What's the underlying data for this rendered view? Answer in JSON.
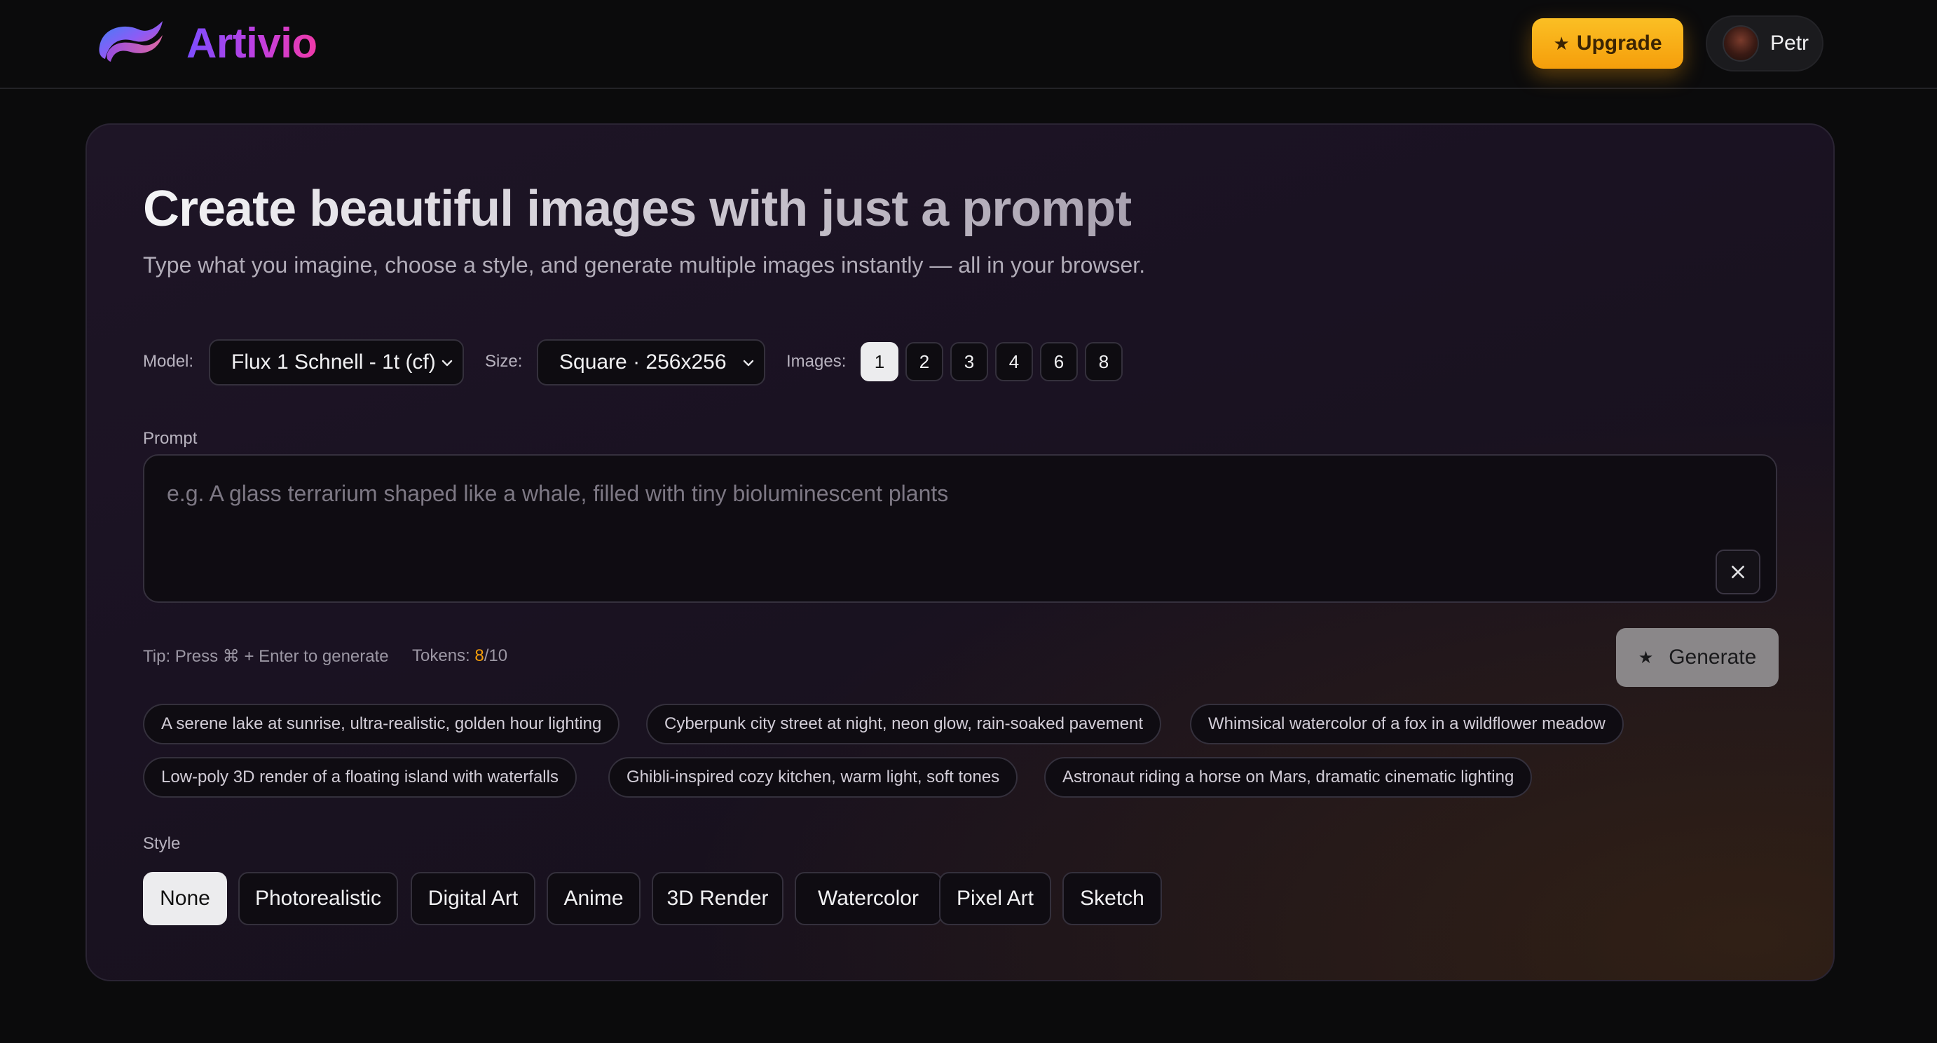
{
  "header": {
    "brand": "Artivio",
    "upgrade_label": "Upgrade",
    "user_name": "Petr"
  },
  "main": {
    "title": "Create beautiful images with just a prompt",
    "subtitle": "Type what you imagine, choose a style, and generate multiple images instantly — all in your browser.",
    "model_label": "Model:",
    "model_value": "Flux 1 Schnell - 1t (cf)",
    "size_label": "Size:",
    "size_value": "Square · 256x256",
    "images_label": "Images:",
    "image_counts": [
      "1",
      "2",
      "3",
      "4",
      "6",
      "8"
    ],
    "image_count_selected": "1",
    "prompt_label": "Prompt",
    "prompt_placeholder": "e.g. A glass terrarium shaped like a whale, filled with tiny bioluminescent plants",
    "prompt_value": "",
    "tip": "Tip: Press ⌘ + Enter to generate",
    "tokens_label": "Tokens:",
    "tokens_used": "8",
    "tokens_total": "/10",
    "generate_label": "Generate",
    "suggestions": [
      "A serene lake at sunrise, ultra-realistic, golden hour lighting",
      "Cyberpunk city street at night, neon glow, rain-soaked pavement",
      "Whimsical watercolor of a fox in a wildflower meadow",
      "Low-poly 3D render of a floating island with waterfalls",
      "Ghibli-inspired cozy kitchen, warm light, soft tones",
      "Astronaut riding a horse on Mars, dramatic cinematic lighting"
    ],
    "style_label": "Style",
    "styles": [
      "None",
      "Photorealistic",
      "Digital Art",
      "Anime",
      "3D Render",
      "Watercolor",
      "Pixel Art",
      "Sketch"
    ],
    "style_selected": "None"
  },
  "icons": {
    "logo": "brand-wave-logo",
    "upgrade": "star-icon",
    "generate": "star-icon",
    "select": "chevron-down-icon",
    "clear": "close-icon"
  },
  "colors": {
    "accent": "#f59e0b",
    "brand_start": "#7c4dff",
    "brand_end": "#ef3aa8"
  }
}
